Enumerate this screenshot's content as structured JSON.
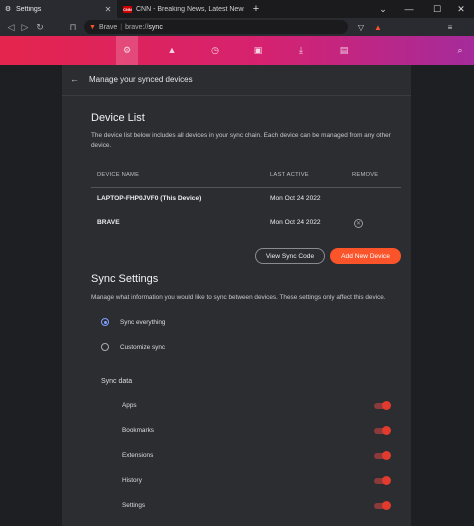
{
  "tabs": [
    {
      "title": "Settings",
      "active": true
    },
    {
      "title": "CNN - Breaking News, Latest News an",
      "active": false,
      "badge": "CNN"
    }
  ],
  "new_tab_symbol": "+",
  "omnibox": {
    "site": "Brave",
    "url_scheme": "brave://",
    "url_path": "sync"
  },
  "band_icons": [
    "gear-icon",
    "warning-icon",
    "history-icon",
    "bookmark-icon",
    "download-icon",
    "wallet-icon",
    "search-icon"
  ],
  "page": {
    "subheader_title": "Manage your synced devices",
    "device_list": {
      "title": "Device List",
      "description": "The device list below includes all devices in your sync chain. Each device can be managed from any other device.",
      "columns": [
        "DEVICE NAME",
        "LAST ACTIVE",
        "REMOVE"
      ],
      "rows": [
        {
          "name": "LAPTOP-FHP0JVF0 (This Device)",
          "last_active": "Mon Oct 24 2022",
          "removable": false
        },
        {
          "name": "BRAVE",
          "last_active": "Mon Oct 24 2022",
          "removable": true
        }
      ],
      "view_code_label": "View Sync Code",
      "add_device_label": "Add New Device"
    },
    "sync_settings": {
      "title": "Sync Settings",
      "description": "Manage what information you would like to sync between devices. These settings only affect this device.",
      "options": [
        {
          "label": "Sync everything",
          "checked": true
        },
        {
          "label": "Customize sync",
          "checked": false
        }
      ],
      "sync_data_title": "Sync data",
      "items": [
        "Apps",
        "Bookmarks",
        "Extensions",
        "History",
        "Settings"
      ]
    }
  },
  "colors": {
    "accent": "#fb542b",
    "band_start": "#e4254d",
    "band_end": "#a52b9b",
    "radio_checked": "#7ea0ff"
  }
}
